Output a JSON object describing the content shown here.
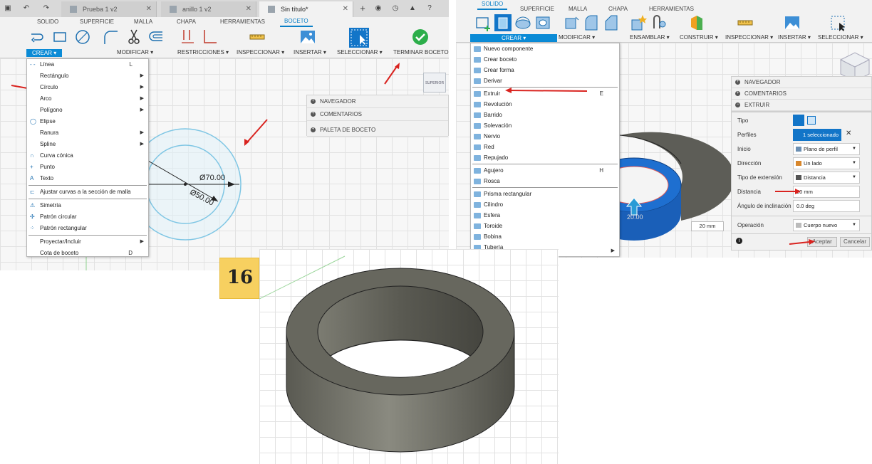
{
  "left": {
    "tabs": [
      {
        "label": "Prueba 1 v2"
      },
      {
        "label": "anillo 1 v2"
      },
      {
        "label": "Sin título*"
      }
    ],
    "workspace_tabs": [
      "SOLIDO",
      "SUPERFICIE",
      "MALLA",
      "CHAPA",
      "HERRAMIENTAS",
      "BOCETO"
    ],
    "ribbon_groups": [
      "CREAR ▾",
      "MODIFICAR ▾",
      "RESTRICCIONES ▾",
      "INSPECCIONAR ▾",
      "INSERTAR ▾",
      "SELECCIONAR ▾",
      "TERMINAR BOCETO ▾"
    ],
    "create_menu": {
      "items": [
        {
          "label": "Línea",
          "shortcut": "L",
          "arrow": ""
        },
        {
          "label": "Rectángulo",
          "shortcut": "",
          "arrow": "▶"
        },
        {
          "label": "Círculo",
          "shortcut": "",
          "arrow": "▶"
        },
        {
          "label": "Arco",
          "shortcut": "",
          "arrow": "▶"
        },
        {
          "label": "Polígono",
          "shortcut": "",
          "arrow": "▶"
        },
        {
          "label": "Elipse",
          "shortcut": "",
          "arrow": ""
        },
        {
          "label": "Ranura",
          "shortcut": "",
          "arrow": "▶"
        },
        {
          "label": "Spline",
          "shortcut": "",
          "arrow": "▶"
        },
        {
          "label": "Curva cónica",
          "shortcut": "",
          "arrow": ""
        },
        {
          "label": "Punto",
          "shortcut": "",
          "arrow": ""
        },
        {
          "label": "Texto",
          "shortcut": "",
          "arrow": ""
        },
        {
          "label": "Ajustar curvas a la sección de malla",
          "shortcut": "",
          "arrow": ""
        },
        {
          "label": "Simetría",
          "shortcut": "",
          "arrow": ""
        },
        {
          "label": "Patrón circular",
          "shortcut": "",
          "arrow": ""
        },
        {
          "label": "Patrón rectangular",
          "shortcut": "",
          "arrow": ""
        },
        {
          "label": "Proyectar/Incluir",
          "shortcut": "",
          "arrow": "▶"
        },
        {
          "label": "Cota de boceto",
          "shortcut": "D",
          "arrow": ""
        }
      ]
    },
    "side_panel": [
      "NAVEGADOR",
      "COMENTARIOS",
      "PALETA DE BOCETO"
    ],
    "view_cube": "SUPERIOR",
    "dimensions": {
      "outer": "Ø70.00",
      "inner": "Ø50.00"
    }
  },
  "right": {
    "workspace_tabs": [
      "SOLIDO",
      "SUPERFICIE",
      "MALLA",
      "CHAPA",
      "HERRAMIENTAS"
    ],
    "ribbon_groups": [
      "CREAR ▾",
      "MODIFICAR ▾",
      "ENSAMBLAR ▾",
      "CONSTRUIR ▾",
      "INSPECCIONAR ▾",
      "INSERTAR ▾",
      "SELECCIONAR ▾"
    ],
    "create_menu": {
      "items": [
        {
          "label": "Nuevo componente",
          "shortcut": ""
        },
        {
          "label": "Crear boceto",
          "shortcut": ""
        },
        {
          "label": "Crear forma",
          "shortcut": ""
        },
        {
          "label": "Derivar",
          "shortcut": ""
        },
        {
          "label": "Extruir",
          "shortcut": "E"
        },
        {
          "label": "Revolución",
          "shortcut": ""
        },
        {
          "label": "Barrido",
          "shortcut": ""
        },
        {
          "label": "Solevación",
          "shortcut": ""
        },
        {
          "label": "Nervio",
          "shortcut": ""
        },
        {
          "label": "Red",
          "shortcut": ""
        },
        {
          "label": "Repujado",
          "shortcut": ""
        },
        {
          "label": "Agujero",
          "shortcut": "H"
        },
        {
          "label": "Rosca",
          "shortcut": ""
        },
        {
          "label": "Prisma rectangular",
          "shortcut": ""
        },
        {
          "label": "Cilindro",
          "shortcut": ""
        },
        {
          "label": "Esfera",
          "shortcut": ""
        },
        {
          "label": "Toroide",
          "shortcut": ""
        },
        {
          "label": "Bobina",
          "shortcut": ""
        },
        {
          "label": "Tubería",
          "shortcut": ""
        }
      ]
    },
    "panels": [
      "NAVEGADOR",
      "COMENTARIOS",
      "EXTRUIR"
    ],
    "extrude_form": {
      "tipo_label": "Tipo",
      "perfiles_label": "Perfiles",
      "perfiles_value": "1 seleccionado",
      "inicio_label": "Inicio",
      "inicio_value": "Plano de perfil",
      "direccion_label": "Dirección",
      "direccion_value": "Un lado",
      "tipo_ext_label": "Tipo de extensión",
      "tipo_ext_value": "Distancia",
      "distancia_label": "Distancia",
      "distancia_value": "20 mm",
      "angulo_label": "Ángulo de inclinación",
      "angulo_value": "0.0 deg",
      "operacion_label": "Operación",
      "operacion_value": "Cuerpo nuevo",
      "accept": "Aceptar",
      "cancel": "Cancelar"
    },
    "viewport_distance": "20 mm",
    "viewport_dim": "20.00"
  },
  "badge": "16",
  "colors": {
    "accent": "#0b8bd6",
    "ring": "#6a6a62",
    "arrow": "#d9231f",
    "sketch": "#7fc6e4"
  }
}
